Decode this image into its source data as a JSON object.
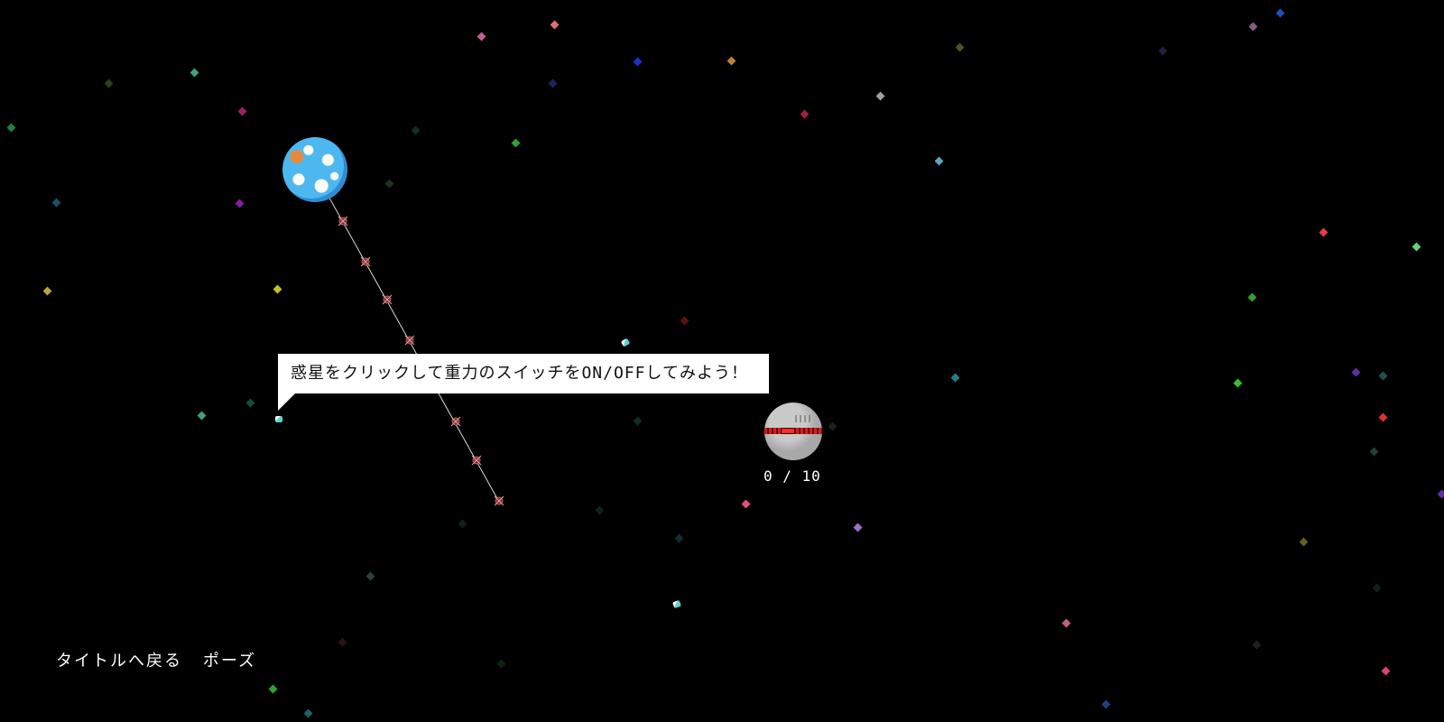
{
  "tutorial": {
    "message": "惑星をクリックして重力のスイッチをON/OFFしてみよう！"
  },
  "goal": {
    "counter_text": "0 / 10",
    "collected": 0,
    "total": 10
  },
  "menu": {
    "back_to_title": "タイトルへ戻る",
    "pause": "ポーズ"
  },
  "colors": {
    "background": "#000000",
    "earth_ocean": "#4db8f0",
    "station_band": "#d02020",
    "tooltip_bg": "#ffffff"
  },
  "icons": {
    "planet": "earth-planet-icon",
    "goal": "space-station-icon",
    "player": "ship-icon"
  }
}
